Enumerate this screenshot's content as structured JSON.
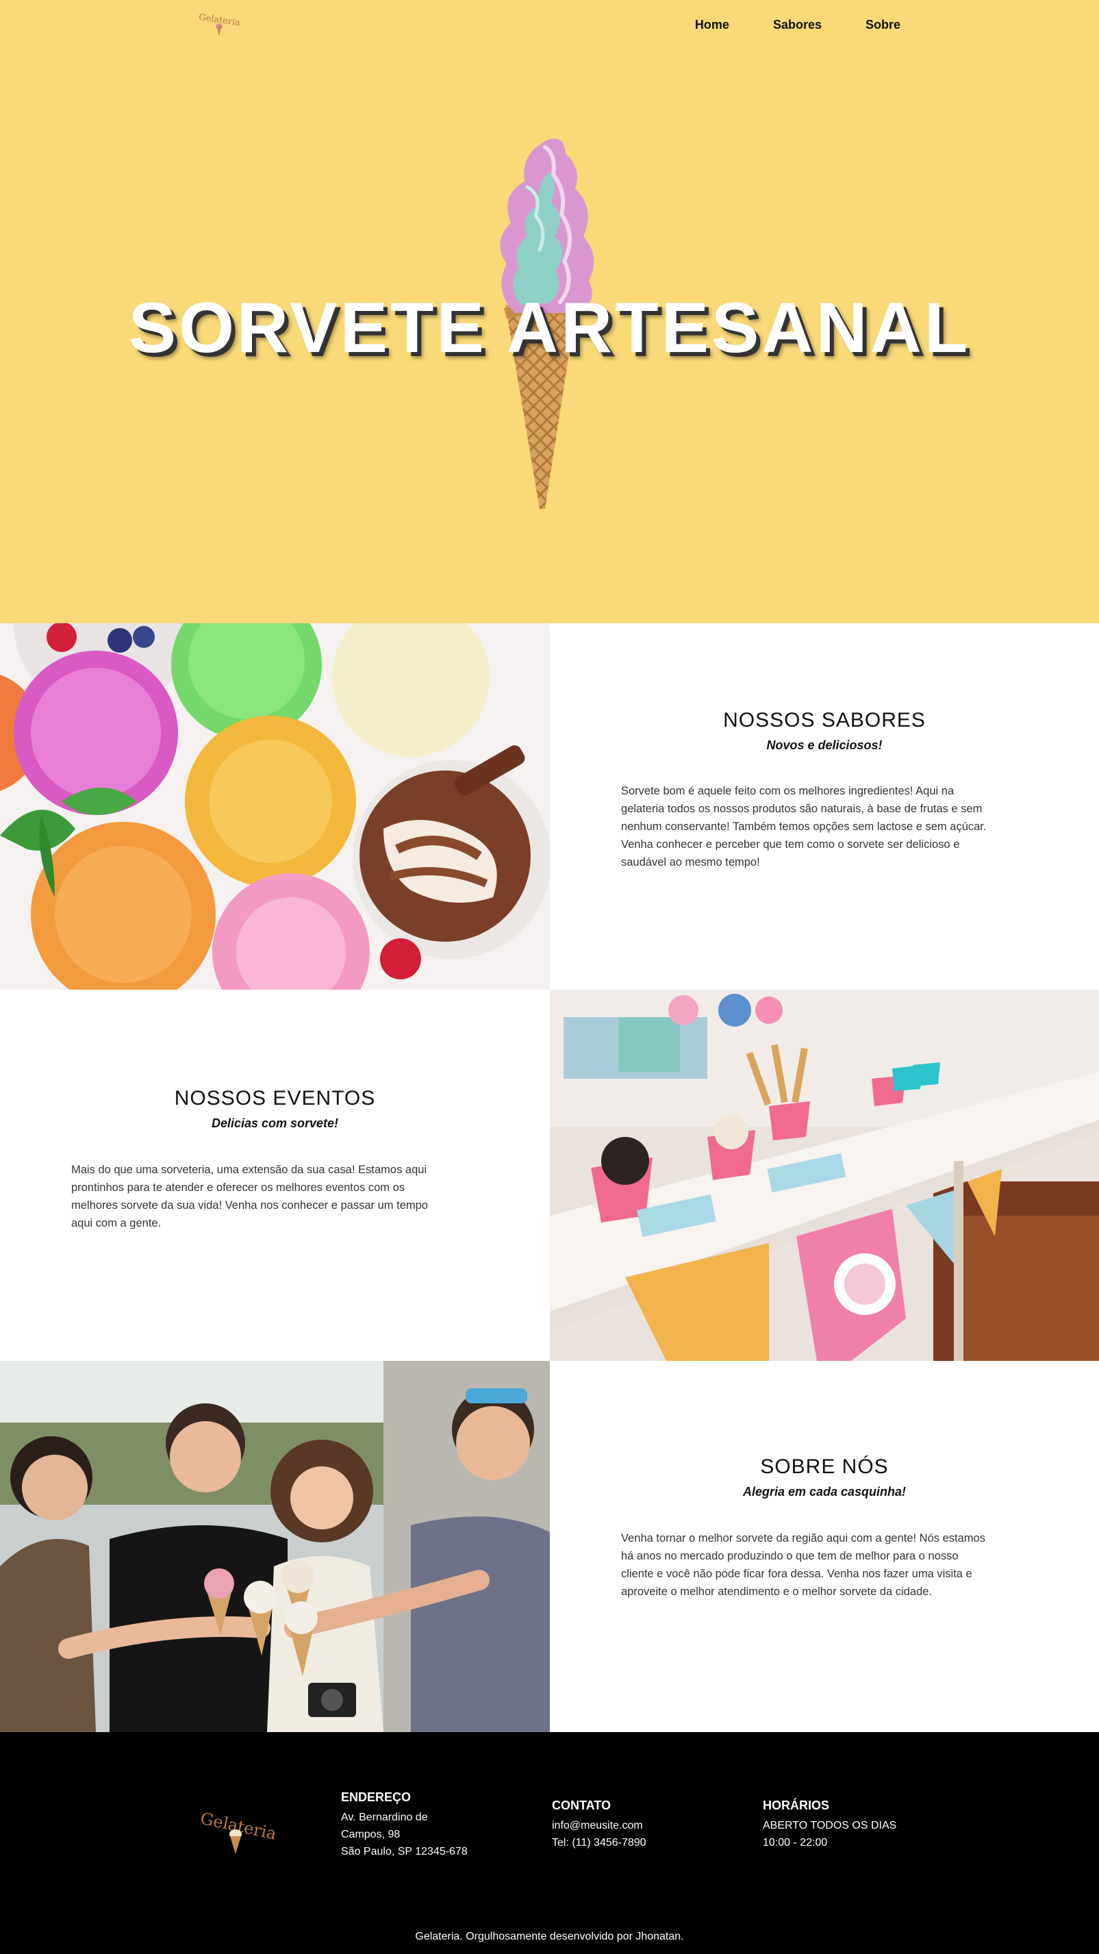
{
  "header": {
    "logo_text": "Gelateria",
    "nav": [
      {
        "label": "Home"
      },
      {
        "label": "Sabores"
      },
      {
        "label": "Sobre"
      }
    ]
  },
  "hero": {
    "title": "SORVETE ARTESANAL"
  },
  "sabores": {
    "title": "NOSSOS SABORES",
    "subtitle": "Novos e deliciosos!",
    "lines": [
      "Sorvete bom é aquele feito com os melhores ingredientes! Aqui na",
      "gelateria todos os nossos produtos são naturais, à base de frutas e sem",
      "nenhum conservante! Também temos opções sem lactose e sem açúcar.",
      "Venha conhecer e perceber que tem como o sorvete ser delicioso e",
      "saudável ao mesmo tempo!"
    ]
  },
  "eventos": {
    "title": "NOSSOS EVENTOS",
    "subtitle": "Delicias com sorvete!",
    "lines": [
      "Mais do que uma sorveteria, uma extensão da sua casa! Estamos aqui",
      "prontinhos para te atender e oferecer os melhores eventos com os",
      "melhores sorvete da sua vida! Venha nos conhecer e passar um tempo",
      "aqui com a gente."
    ]
  },
  "sobre": {
    "title": "SOBRE NÓS",
    "subtitle": "Alegria em cada casquinha!",
    "lines": [
      "Venha tornar o melhor sorvete da região aqui com a gente! Nós estamos",
      "há anos no mercado produzindo o que tem de melhor para o nosso",
      "cliente e você não pode ficar fora dessa. Venha nos fazer uma visita e",
      "aproveite o melhor atendimento e o melhor sorvete da cidade."
    ]
  },
  "footer": {
    "logo_text": "Gelateria",
    "endereco": {
      "title": "ENDEREÇO",
      "lines": [
        "Av. Bernardino de",
        "Campos, 98",
        "São Paulo, SP 12345-678"
      ]
    },
    "contato": {
      "title": "CONTATO",
      "lines": [
        "info@meusite.com",
        "Tel: (11) 3456-7890"
      ]
    },
    "horarios": {
      "title": "HORÁRIOS",
      "lines": [
        "ABERTO TODOS OS DIAS",
        "10:00 - 22:00"
      ]
    },
    "copyright": "Gelateria. Orgulhosamente desenvolvido por Jhonatan."
  },
  "colors": {
    "hero_bg": "#f9d978",
    "footer_bg": "#000000",
    "logo_brown": "#b8784a"
  }
}
